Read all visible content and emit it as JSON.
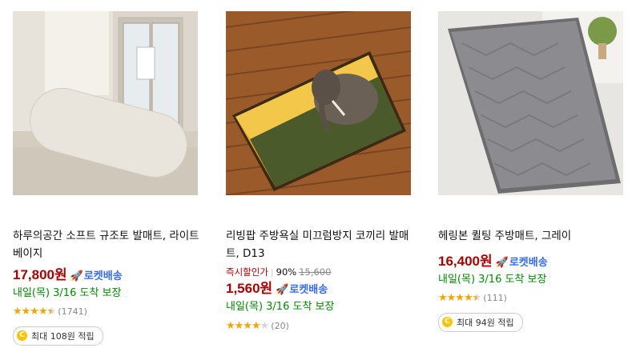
{
  "products": [
    {
      "name": "하루의공간 소프트 규조토 발매트, 라이트 베이지",
      "price": "17,800원",
      "badge": "로켓배송",
      "delivery": "내일(목) 3/16 도착 보장",
      "rating": 4.5,
      "review_count": "(1741)",
      "cashback": "최대 108원 적립",
      "coin_symbol": "C"
    },
    {
      "name": "리빙팝 주방욕실 미끄럼방지 코끼리 발매트, D13",
      "discount_label": "즉시할인가",
      "discount_rate": "90%",
      "original_price": "15,600",
      "price": "1,560원",
      "badge": "로켓배송",
      "delivery": "내일(목) 3/16 도착 보장",
      "rating": 4.0,
      "review_count": "(20)"
    },
    {
      "name": "헤링본 퀼팅 주방매트, 그레이",
      "price": "16,400원",
      "badge": "로켓배송",
      "delivery": "내일(목) 3/16 도착 보장",
      "rating": 4.5,
      "review_count": "(111)",
      "cashback": "최대 94원 적립",
      "coin_symbol": "C"
    }
  ],
  "colors": {
    "price": "#ae0000",
    "rocket": "#346aff",
    "delivery": "#008c00",
    "star": "#f7a400"
  },
  "icons": {
    "rocket": "rocket-icon",
    "star": "star-icon",
    "coin": "coin-icon"
  }
}
